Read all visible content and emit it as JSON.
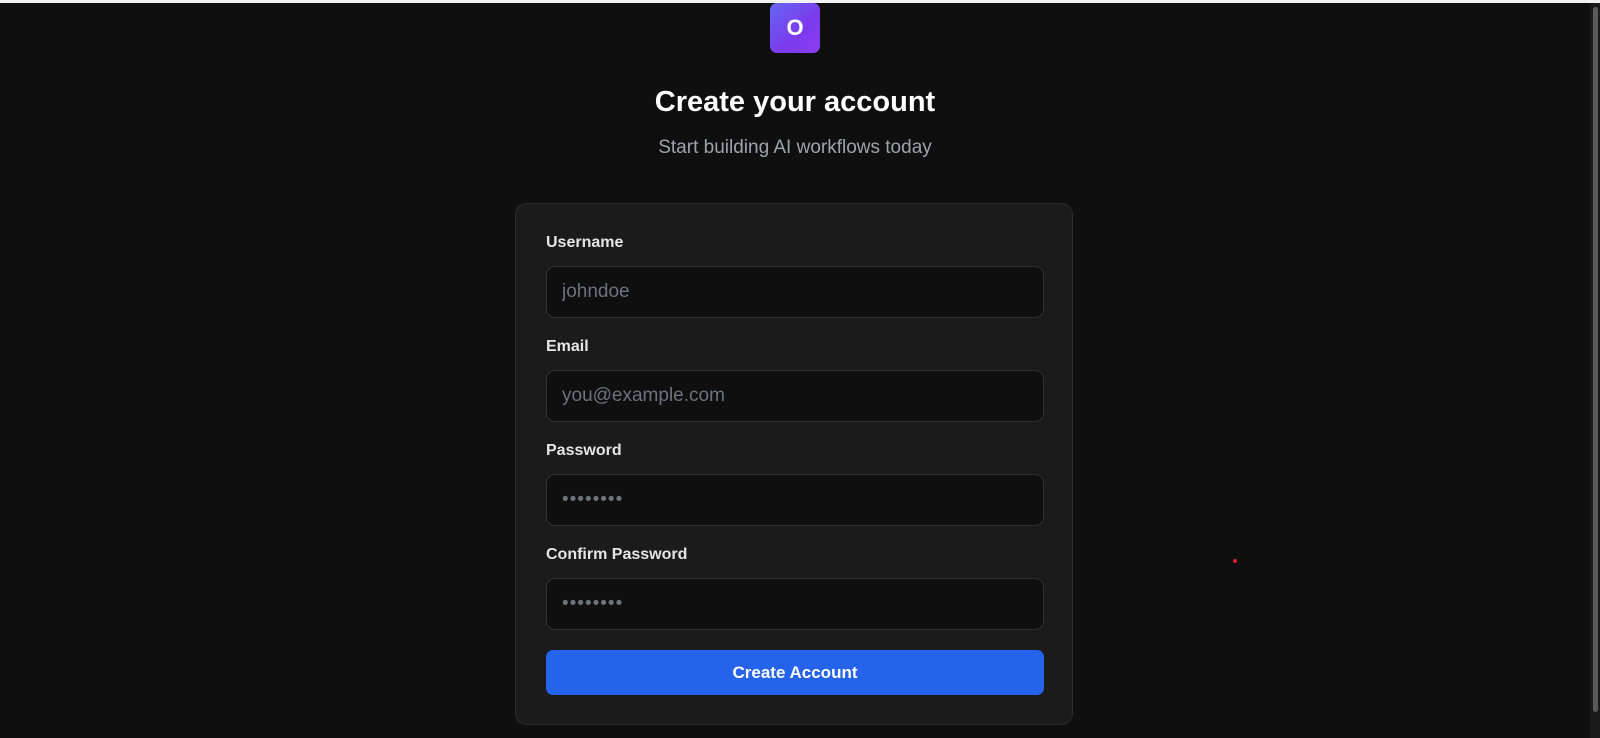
{
  "logo": {
    "letter": "O"
  },
  "header": {
    "title": "Create your account",
    "subtitle": "Start building AI workflows today"
  },
  "form": {
    "username": {
      "label": "Username",
      "placeholder": "johndoe",
      "value": ""
    },
    "email": {
      "label": "Email",
      "placeholder": "you@example.com",
      "value": ""
    },
    "password": {
      "label": "Password",
      "placeholder": "••••••••",
      "value": ""
    },
    "confirm_password": {
      "label": "Confirm Password",
      "placeholder": "••••••••",
      "value": ""
    },
    "submit_label": "Create Account"
  },
  "colors": {
    "background": "#0f0f0f",
    "card": "#1b1b1b",
    "accent": "#2563eb",
    "logo_gradient_start": "#6366f1",
    "logo_gradient_end": "#8b3ff0"
  }
}
